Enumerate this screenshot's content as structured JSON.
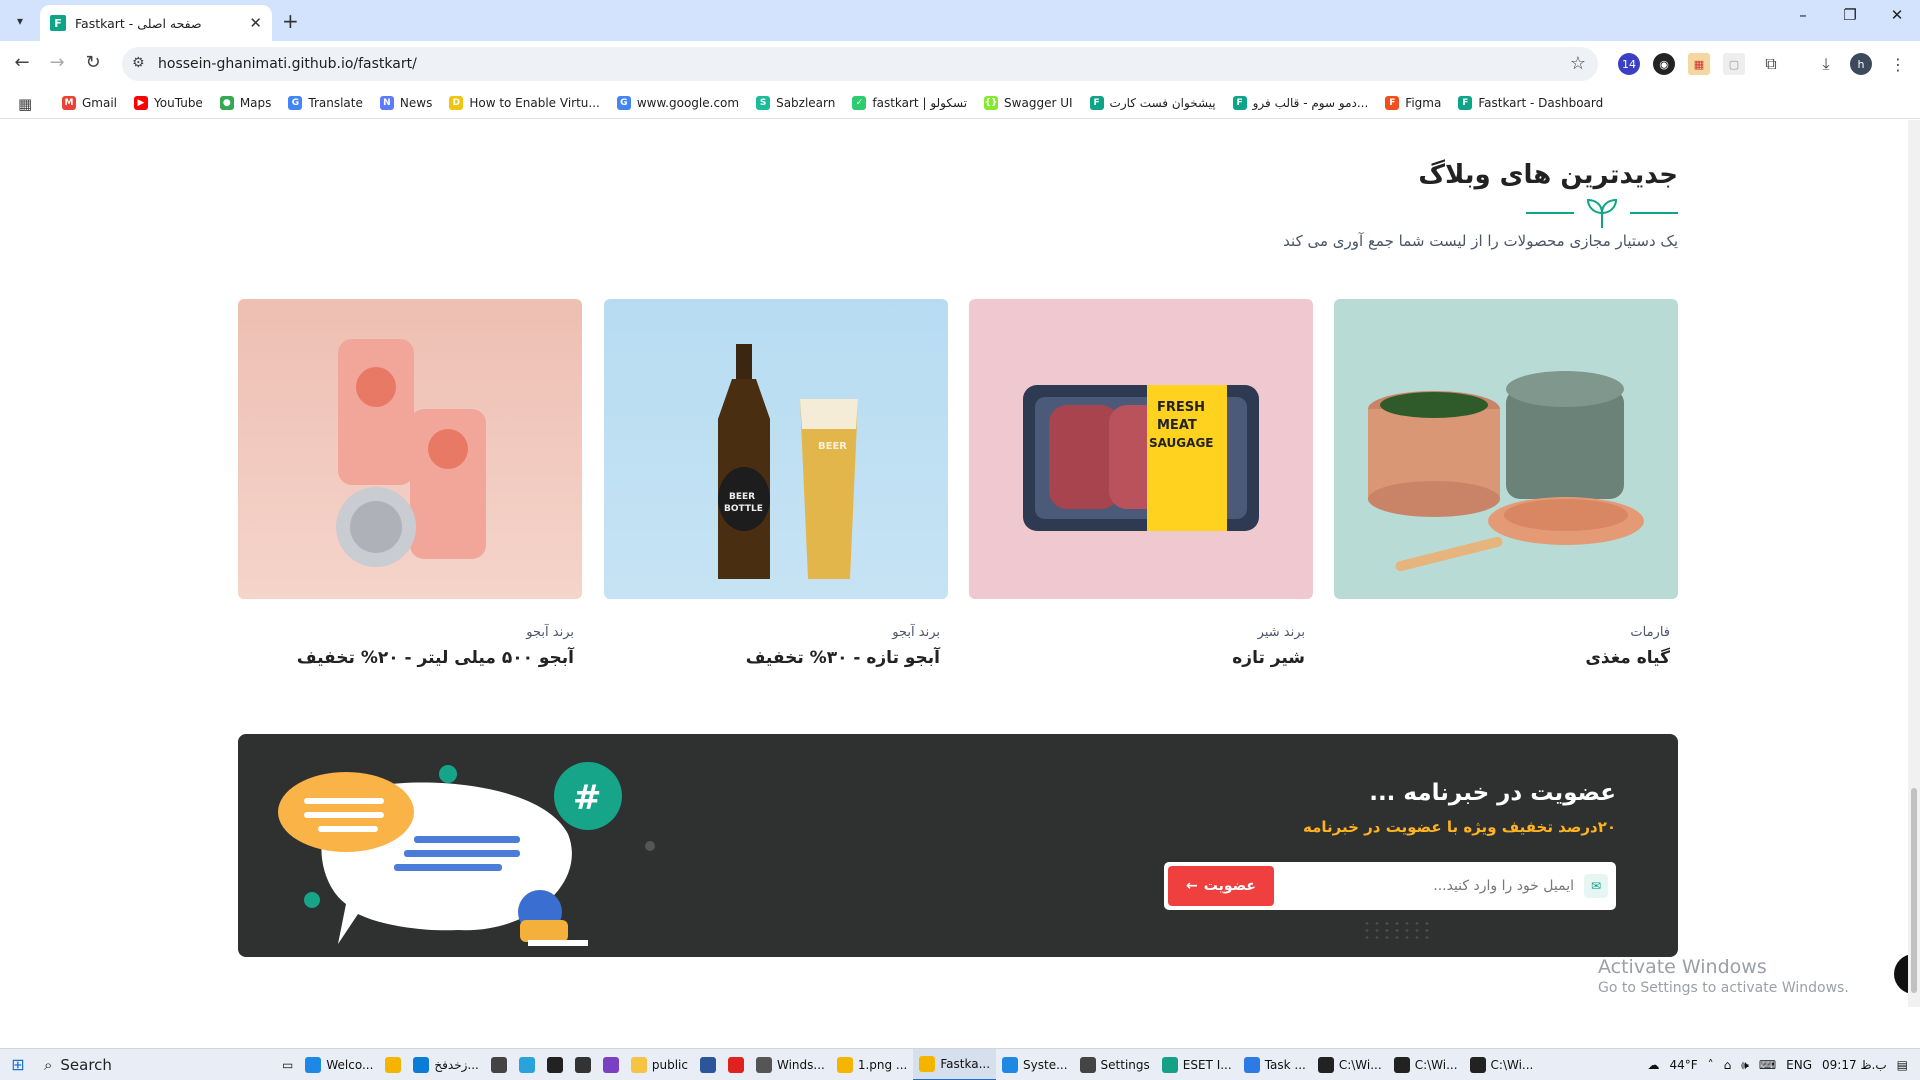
{
  "browser": {
    "tab_title": "Fastkart - صفحه اصلی",
    "tab_favicon_letter": "F",
    "url": "hossein-ghanimati.github.io/fastkart/",
    "profile_initial": "h",
    "extension_badge": "14",
    "window_controls": [
      "–",
      "❐",
      "✕"
    ]
  },
  "bookmarks": [
    {
      "label": "Gmail",
      "icon": "gmail-icon",
      "color": "#ea4335",
      "glyph": "M"
    },
    {
      "label": "YouTube",
      "icon": "youtube-icon",
      "color": "#ff0000",
      "glyph": "▶"
    },
    {
      "label": "Maps",
      "icon": "maps-icon",
      "color": "#34a853",
      "glyph": "●"
    },
    {
      "label": "Translate",
      "icon": "translate-icon",
      "color": "#4285f4",
      "glyph": "G"
    },
    {
      "label": "News",
      "icon": "news-icon",
      "color": "#5c7cfa",
      "glyph": "N"
    },
    {
      "label": "How to Enable Virtu...",
      "icon": "site-icon",
      "color": "#f1c40f",
      "glyph": "D"
    },
    {
      "label": "www.google.com",
      "icon": "google-icon",
      "color": "#4285f4",
      "glyph": "G"
    },
    {
      "label": "Sabzlearn",
      "icon": "sabzlearn-icon",
      "color": "#1abc9c",
      "glyph": "S"
    },
    {
      "label": "fastkart | تسکولو",
      "icon": "check-icon",
      "color": "#2ecc71",
      "glyph": "✓"
    },
    {
      "label": "Swagger UI",
      "icon": "swagger-icon",
      "color": "#85ea2d",
      "glyph": "{}"
    },
    {
      "label": "پیشخوان فست کارت",
      "icon": "fastkart-icon",
      "color": "#0da487",
      "glyph": "F"
    },
    {
      "label": "دمو سوم - قالب فرو...",
      "icon": "fastkart-icon",
      "color": "#0da487",
      "glyph": "F"
    },
    {
      "label": "Figma",
      "icon": "figma-icon",
      "color": "#f24e1e",
      "glyph": "F"
    },
    {
      "label": "Fastkart - Dashboard",
      "icon": "fastkart-icon",
      "color": "#0da487",
      "glyph": "F"
    }
  ],
  "blog": {
    "title": "جدیدترین های وبلاگ",
    "subtitle": "یک دستیار مجازی محصولات را از لیست شما جمع آوری می کند",
    "accent_color": "#0da487",
    "cards": [
      {
        "category": "فارمات",
        "name": "گیاه مغذی"
      },
      {
        "category": "برند شیر",
        "name": "شیر تازه"
      },
      {
        "category": "برند آبجو",
        "name": "آبجو تازه - ۳۰% تخفیف"
      },
      {
        "category": "برند آبجو",
        "name": "آبجو ۵۰۰ میلی لیتر - ۲۰% تخفیف"
      }
    ]
  },
  "newsletter": {
    "title": "عضویت در خبرنامه ...",
    "subtitle": "۲۰درصد تخفیف ویژه با عضویت در خبرنامه",
    "placeholder": "ایمیل خود را وارد کنید...",
    "button_label": "عضویت",
    "button_color": "#ef3f3e",
    "subtitle_color": "#ffb321"
  },
  "windows_watermark": {
    "line1": "Activate Windows",
    "line2": "Go to Settings to activate Windows."
  },
  "taskbar": {
    "search_label": "Search",
    "items": [
      {
        "label": "Welco...",
        "icon": "vscode-icon",
        "color": "#1e88e5"
      },
      {
        "label": "",
        "icon": "chrome-icon",
        "color": "#f4b400"
      },
      {
        "label": "زخدفخ...",
        "icon": "edge-icon",
        "color": "#0a7bd6"
      },
      {
        "label": "",
        "icon": "store-icon",
        "color": "#444"
      },
      {
        "label": "",
        "icon": "telegram-icon",
        "color": "#2aa3dd"
      },
      {
        "label": "",
        "icon": "pycharm-icon",
        "color": "#222"
      },
      {
        "label": "",
        "icon": "obs-icon",
        "color": "#333"
      },
      {
        "label": "",
        "icon": "vs-icon",
        "color": "#7b3fc4"
      },
      {
        "label": "public",
        "icon": "folder-icon",
        "color": "#f6c343"
      },
      {
        "label": "",
        "icon": "word-icon",
        "color": "#2b579a"
      },
      {
        "label": "",
        "icon": "opera-icon",
        "color": "#e0221e"
      },
      {
        "label": "Winds...",
        "icon": "wordpress-icon",
        "color": "#555"
      },
      {
        "label": "1.png ...",
        "icon": "chrome-icon",
        "color": "#f4b400"
      },
      {
        "label": "Fastka...",
        "icon": "chrome-icon",
        "color": "#f4b400",
        "active": true
      },
      {
        "label": "Syste...",
        "icon": "system-icon",
        "color": "#1e88e5"
      },
      {
        "label": "Settings",
        "icon": "gear-icon",
        "color": "#444"
      },
      {
        "label": "ESET I...",
        "icon": "eset-icon",
        "color": "#16a085"
      },
      {
        "label": "Task ...",
        "icon": "taskmgr-icon",
        "color": "#2c7be5"
      },
      {
        "label": "C:\\Wi...",
        "icon": "cmd-icon",
        "color": "#222"
      },
      {
        "label": "C:\\Wi...",
        "icon": "cmd-icon",
        "color": "#222"
      },
      {
        "label": "C:\\Wi...",
        "icon": "cmd-icon",
        "color": "#222"
      }
    ],
    "weather": "44°F",
    "language": "ENG",
    "clock": "09:17 ب.ظ"
  }
}
